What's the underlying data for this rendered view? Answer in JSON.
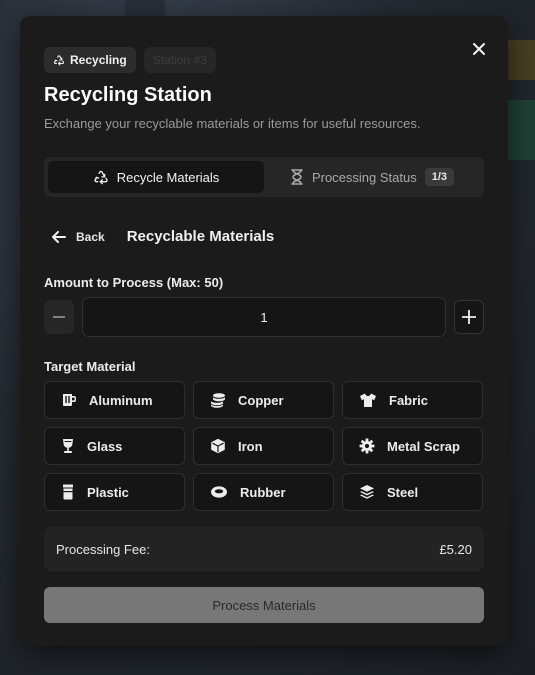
{
  "header": {
    "badge_primary": "Recycling",
    "badge_secondary": "Station #3",
    "title": "Recycling Station",
    "subtitle": "Exchange your recyclable materials or items for useful resources."
  },
  "tabs": [
    {
      "label": "Recycle Materials",
      "icon": "recycle-icon",
      "active": true
    },
    {
      "label": "Processing Status",
      "icon": "hourglass-icon",
      "count": "1/3",
      "active": false
    }
  ],
  "nav": {
    "back_label": "Back",
    "section_title": "Recyclable Materials"
  },
  "amount": {
    "label": "Amount to Process (Max: 50)",
    "value": "1"
  },
  "target": {
    "label": "Target Material",
    "materials": [
      {
        "label": "Aluminum",
        "icon": "mug-icon"
      },
      {
        "label": "Copper",
        "icon": "coins-icon"
      },
      {
        "label": "Fabric",
        "icon": "shirt-icon"
      },
      {
        "label": "Glass",
        "icon": "wine-glass-icon"
      },
      {
        "label": "Iron",
        "icon": "cube-icon"
      },
      {
        "label": "Metal Scrap",
        "icon": "gear-icon"
      },
      {
        "label": "Plastic",
        "icon": "bottle-icon"
      },
      {
        "label": "Rubber",
        "icon": "ring-icon"
      },
      {
        "label": "Steel",
        "icon": "layers-icon"
      }
    ]
  },
  "fee": {
    "label": "Processing Fee:",
    "value": "£5.20"
  },
  "action": {
    "process_label": "Process Materials"
  },
  "colors": {
    "panel": "#1b1b1b",
    "button_disabled": "#777777"
  }
}
